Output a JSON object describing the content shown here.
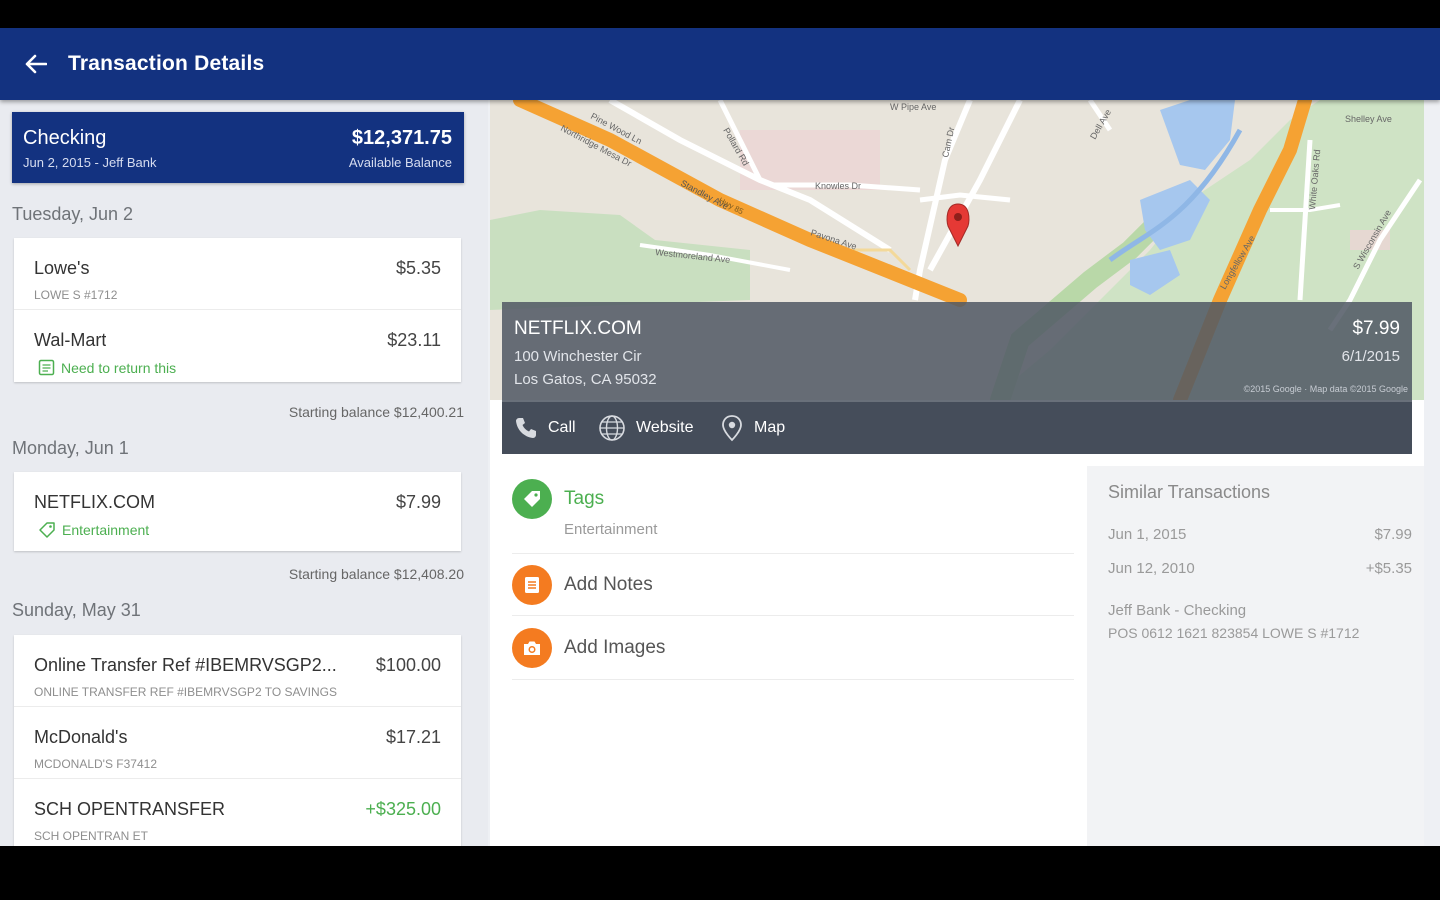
{
  "app": {
    "title": "Transaction Details"
  },
  "colors": {
    "brand": "#133280",
    "accent_green": "#4caf50",
    "accent_orange": "#f47b20"
  },
  "account": {
    "name": "Checking",
    "subtitle": "Jun 2, 2015 - Jeff Bank",
    "balance": "$12,371.75",
    "balance_label": "Available Balance"
  },
  "groups": [
    {
      "day": "Tuesday, Jun 2",
      "transactions": [
        {
          "name": "Lowe's",
          "amount": "$5.35",
          "sub": "LOWE S #1712"
        },
        {
          "name": "Wal-Mart",
          "amount": "$23.11",
          "note": "Need to return this",
          "note_icon": "note-icon"
        }
      ],
      "starting_balance": "Starting balance $12,400.21"
    },
    {
      "day": "Monday, Jun 1",
      "transactions": [
        {
          "name": "NETFLIX.COM",
          "amount": "$7.99",
          "note": "Entertainment",
          "note_icon": "tag-icon"
        }
      ],
      "starting_balance": "Starting balance $12,408.20"
    },
    {
      "day": "Sunday, May 31",
      "transactions": [
        {
          "name": "Online Transfer Ref #IBEMRVSGP2...",
          "amount": "$100.00",
          "sub": "ONLINE TRANSFER REF #IBEMRVSGP2 TO SAVINGS"
        },
        {
          "name": "McDonald's",
          "amount": "$17.21",
          "sub": "MCDONALD'S F37412"
        },
        {
          "name": "SCH OPENTRANSFER",
          "amount": "+$325.00",
          "sub": "SCH OPENTRAN ET"
        }
      ]
    }
  ],
  "map": {
    "streets": [
      "W Pipe Ave",
      "Pine Wood Ln",
      "Northridge Mesa Dr",
      "Standley Ave",
      "Knowles Dr",
      "Pavona Ave",
      "Westmoreland Ave",
      "Dell Ave",
      "Shelley Ave",
      "White Oaks Rd",
      "Cam Dr",
      "Pollard Rd",
      "Longfellow Ave",
      "S Wisconsin Ave",
      "Hwy 85"
    ],
    "attribution": "©2015 Google · Map data ©2015 Google",
    "pin_icon": "map-pin-icon"
  },
  "detail": {
    "merchant": "NETFLIX.COM",
    "address_line1": "100 Winchester Cir",
    "address_line2": "Los Gatos, CA 95032",
    "amount": "$7.99",
    "date": "6/1/2015",
    "actions": [
      {
        "label": "Call",
        "icon": "phone-icon"
      },
      {
        "label": "Website",
        "icon": "globe-icon"
      },
      {
        "label": "Map",
        "icon": "map-marker-icon"
      }
    ]
  },
  "sections": {
    "tags": {
      "label": "Tags",
      "value": "Entertainment",
      "icon": "tag-icon"
    },
    "notes": {
      "label": "Add Notes",
      "icon": "notes-icon"
    },
    "images": {
      "label": "Add Images",
      "icon": "camera-icon"
    }
  },
  "similar": {
    "title": "Similar Transactions",
    "rows": [
      {
        "date": "Jun 1, 2015",
        "amount": "$7.99"
      },
      {
        "date": "Jun 12, 2010",
        "amount": "+$5.35"
      }
    ],
    "account": "Jeff Bank - Checking",
    "description": "POS 0612 1621 823854 LOWE S #1712"
  }
}
